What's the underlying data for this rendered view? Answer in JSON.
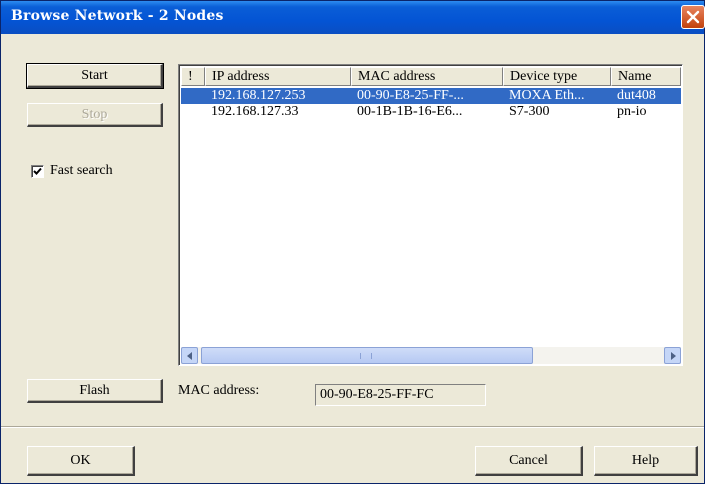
{
  "window": {
    "title": "Browse Network - 2 Nodes"
  },
  "buttons": {
    "start": "Start",
    "stop": "Stop",
    "flash": "Flash",
    "ok": "OK",
    "cancel": "Cancel",
    "help": "Help"
  },
  "fast_search": {
    "label": "Fast search",
    "checked": true
  },
  "table": {
    "columns": [
      "!",
      "IP address",
      "MAC address",
      "Device type",
      "Name"
    ],
    "rows": [
      {
        "flag": "",
        "ip": "192.168.127.253",
        "mac": "00-90-E8-25-FF-...",
        "type": "MOXA Eth...",
        "name": "dut408",
        "selected": true
      },
      {
        "flag": "",
        "ip": "192.168.127.33",
        "mac": "00-1B-1B-16-E6...",
        "type": "S7-300",
        "name": "pn-io",
        "selected": false
      }
    ]
  },
  "mac_field": {
    "label": "MAC address:",
    "value": "00-90-E8-25-FF-FC"
  },
  "icons": {
    "close": "close-icon",
    "scroll_left": "arrow-left-icon",
    "scroll_right": "arrow-right-icon",
    "check": "checkmark-icon"
  },
  "colors": {
    "titlebar": "#0454d4",
    "selection": "#316ac5",
    "dialog_bg": "#ece9d8"
  }
}
